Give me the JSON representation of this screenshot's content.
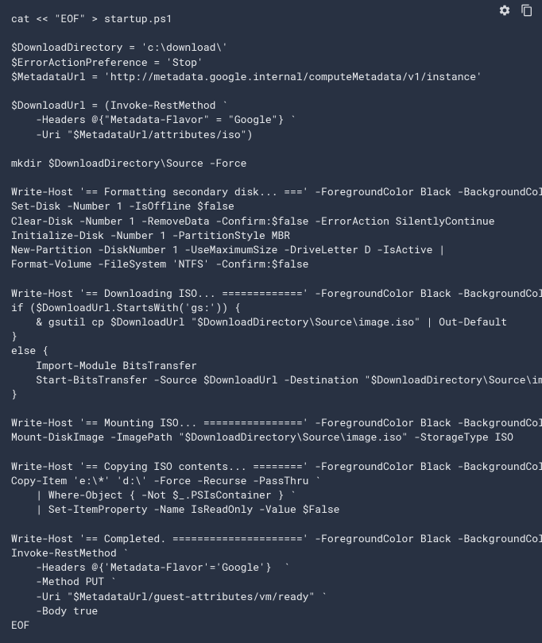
{
  "toolbar": {
    "settings_icon": "gear-icon",
    "copy_icon": "copy-icon"
  },
  "code": {
    "lines": [
      "cat << \"EOF\" > startup.ps1",
      "",
      "$DownloadDirectory = 'c:\\download\\'",
      "$ErrorActionPreference = 'Stop'",
      "$MetadataUrl = 'http://metadata.google.internal/computeMetadata/v1/instance'",
      "",
      "$DownloadUrl = (Invoke-RestMethod `",
      "    -Headers @{\"Metadata-Flavor\" = \"Google\"} `",
      "    -Uri \"$MetadataUrl/attributes/iso\")",
      "",
      "mkdir $DownloadDirectory\\Source -Force",
      "",
      "Write-Host '== Formatting secondary disk... ===' -ForegroundColor Black -BackgroundColor Yellow",
      "Set-Disk -Number 1 -IsOffline $false",
      "Clear-Disk -Number 1 -RemoveData -Confirm:$false -ErrorAction SilentlyContinue",
      "Initialize-Disk -Number 1 -PartitionStyle MBR",
      "New-Partition -DiskNumber 1 -UseMaximumSize -DriveLetter D -IsActive |",
      "Format-Volume -FileSystem 'NTFS' -Confirm:$false",
      "",
      "Write-Host '== Downloading ISO... =============' -ForegroundColor Black -BackgroundColor Yellow",
      "if ($DownloadUrl.StartsWith('gs:')) {",
      "    & gsutil cp $DownloadUrl \"$DownloadDirectory\\Source\\image.iso\" | Out-Default",
      "}",
      "else {",
      "    Import-Module BitsTransfer",
      "    Start-BitsTransfer -Source $DownloadUrl -Destination \"$DownloadDirectory\\Source\\image.iso\"",
      "}",
      "",
      "Write-Host '== Mounting ISO... ================' -ForegroundColor Black -BackgroundColor Yellow",
      "Mount-DiskImage -ImagePath \"$DownloadDirectory\\Source\\image.iso\" -StorageType ISO",
      "",
      "Write-Host '== Copying ISO contents... ========' -ForegroundColor Black -BackgroundColor Yellow",
      "Copy-Item 'e:\\*' 'd:\\' -Force -Recurse -PassThru `",
      "    | Where-Object { -Not $_.PSIsContainer } `",
      "    | Set-ItemProperty -Name IsReadOnly -Value $False",
      "",
      "Write-Host '== Completed. =====================' -ForegroundColor Black -BackgroundColor Yellow",
      "Invoke-RestMethod `",
      "    -Headers @{'Metadata-Flavor'='Google'}  `",
      "    -Method PUT `",
      "    -Uri \"$MetadataUrl/guest-attributes/vm/ready\" `",
      "    -Body true",
      "EOF"
    ]
  }
}
